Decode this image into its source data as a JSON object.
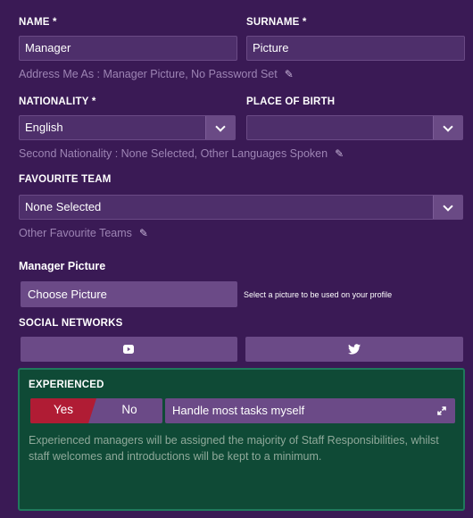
{
  "name": {
    "label": "NAME *",
    "value": "Manager"
  },
  "surname": {
    "label": "SURNAME *",
    "value": "Picture"
  },
  "address_hint": "Address Me As : Manager Picture, No Password Set",
  "nationality": {
    "label": "NATIONALITY *",
    "value": "English"
  },
  "place_of_birth": {
    "label": "PLACE OF BIRTH",
    "value": ""
  },
  "nationality_hint": "Second Nationality : None Selected, Other Languages Spoken",
  "favourite_team": {
    "label": "FAVOURITE TEAM",
    "value": "None Selected"
  },
  "favourite_hint": "Other Favourite Teams",
  "manager_picture": {
    "label": "Manager Picture",
    "button": "Choose Picture",
    "note": "Select a picture to be used on your profile"
  },
  "social": {
    "label": "SOCIAL NETWORKS",
    "items": [
      "youtube-icon",
      "twitter-icon"
    ]
  },
  "experience": {
    "label": "EXPERIENCED",
    "yes": "Yes",
    "no": "No",
    "selected": "Yes",
    "dropdown": "Handle most tasks myself",
    "description": "Experienced managers will be assigned the majority of Staff Responsibilities, whilst staff welcomes and introductions will be kept to a minimum."
  },
  "colors": {
    "background": "#3a1a55",
    "field": "#4e2f6b",
    "accent_red": "#b01c34",
    "panel_green": "#0f4a36"
  }
}
